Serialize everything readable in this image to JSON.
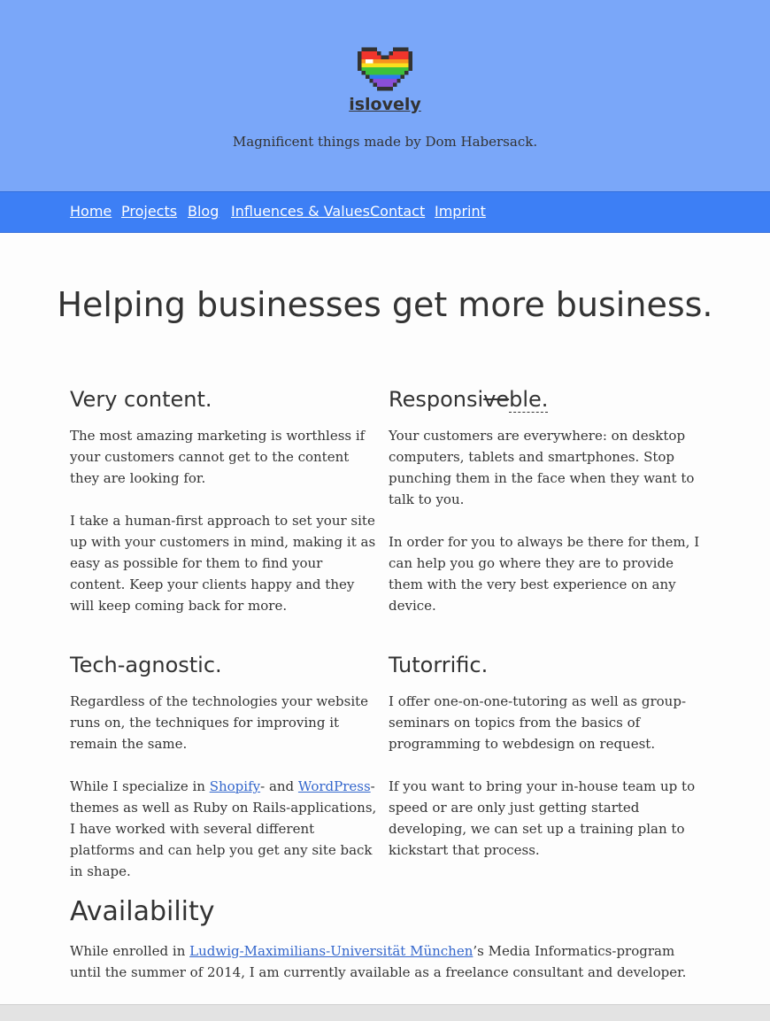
{
  "header": {
    "site_name": "islovely",
    "tagline": "Magnificent things made by Dom Habersack.",
    "logo_icon": "rainbow-pixel-heart-icon",
    "background": "#7aa7f9"
  },
  "nav": {
    "background": "#3d7ff5",
    "items": [
      "Home",
      "Projects",
      "Blog",
      "Influences & Values",
      "Contact",
      "Imprint"
    ]
  },
  "hero": {
    "title": "Helping businesses get more business."
  },
  "sections": {
    "content": {
      "title": "Very content.",
      "p1": "The most amazing marketing is worthless if your customers cannot get to the content they are looking for.",
      "p2": "I take a human-first approach to set your site up with your customers in mind, making it as easy as possible for them to find your content. Keep your clients happy and they will keep coming back for more."
    },
    "responsive": {
      "title_prefix": "Responsi",
      "title_struck": "ve",
      "title_suffix": "ble.",
      "p1": "Your customers are everywhere: on desktop computers, tablets and smartphones. Stop punching them in the face when they want to talk to you.",
      "p2": "In order for you to always be there for them, I can help you go where they are to provide them with the very best experience on any device."
    },
    "tech": {
      "title": "Tech-agnostic.",
      "p1": "Regardless of the technologies your website runs on, the techniques for improving it remain the same.",
      "p2_before": "While I specialize in ",
      "link_shopify": "Shopify",
      "p2_mid": "- and ",
      "link_wordpress": "WordPress",
      "p2_after": "-themes as well as Ruby on Rails-applications, I have worked with several different platforms and can help you get any site back in shape."
    },
    "tutor": {
      "title": "Tutorrific.",
      "p1": "I offer one-on-one-tutoring as well as group-seminars on topics from the basics of programming to webdesign on request.",
      "p2": "If you want to bring your in-house team up to speed or are only just getting started developing, we can set up a training plan to kickstart that process."
    }
  },
  "availability": {
    "title": "Availability",
    "before": "While enrolled in ",
    "link": "Ludwig-Maximilians-Universität München",
    "after": "’s Media Informatics-program until the summer of 2014, I am currently available as a freelance consultant and developer."
  },
  "colors": {
    "link": "#3366cc",
    "text": "#333333"
  }
}
